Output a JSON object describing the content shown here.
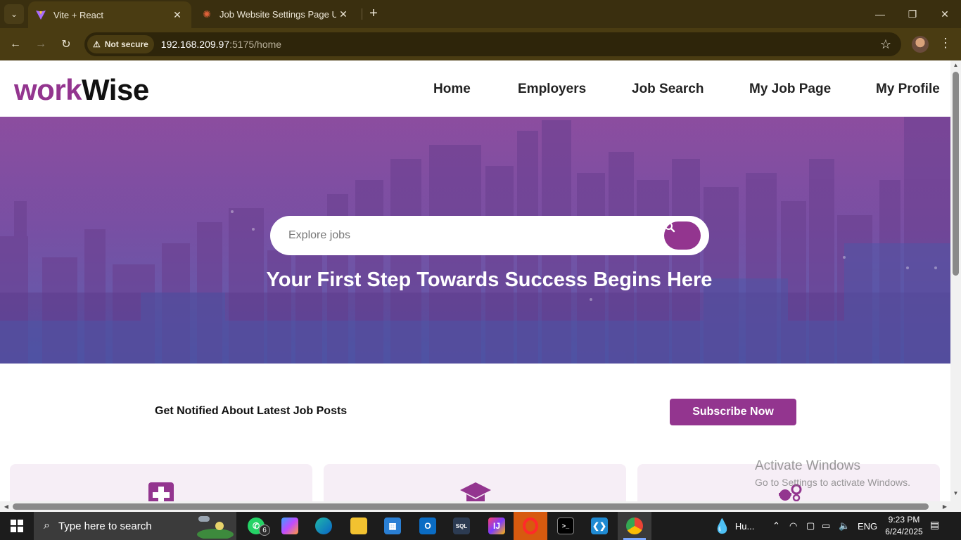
{
  "browser": {
    "tabs": [
      {
        "title": "Vite + React",
        "active": true
      },
      {
        "title": "Job Website Settings Page UI - ",
        "active": false
      }
    ],
    "security_label": "Not secure",
    "url_host": "192.168.209.97",
    "url_path": ":5175/home"
  },
  "site": {
    "logo_part1": "work",
    "logo_part2": "Wise",
    "nav": [
      "Home",
      "Employers",
      "Job Search",
      "My Job Page",
      "My Profile"
    ],
    "search_placeholder": "Explore jobs",
    "tagline": "Your First Step Towards Success Begins Here",
    "notify_text": "Get Notified About Latest Job Posts",
    "subscribe_label": "Subscribe Now",
    "brand_color": "#93358f",
    "cards": [
      {
        "icon": "medical-cross-icon"
      },
      {
        "icon": "graduation-cap-icon"
      },
      {
        "icon": "worker-gear-icon"
      }
    ]
  },
  "watermark": {
    "line1": "Activate Windows",
    "line2": "Go to Settings to activate Windows."
  },
  "taskbar": {
    "search_placeholder": "Type here to search",
    "whatsapp_badge": "6",
    "weather": "Hu...",
    "language": "ENG",
    "time": "9:23 PM",
    "date": "6/24/2025"
  }
}
